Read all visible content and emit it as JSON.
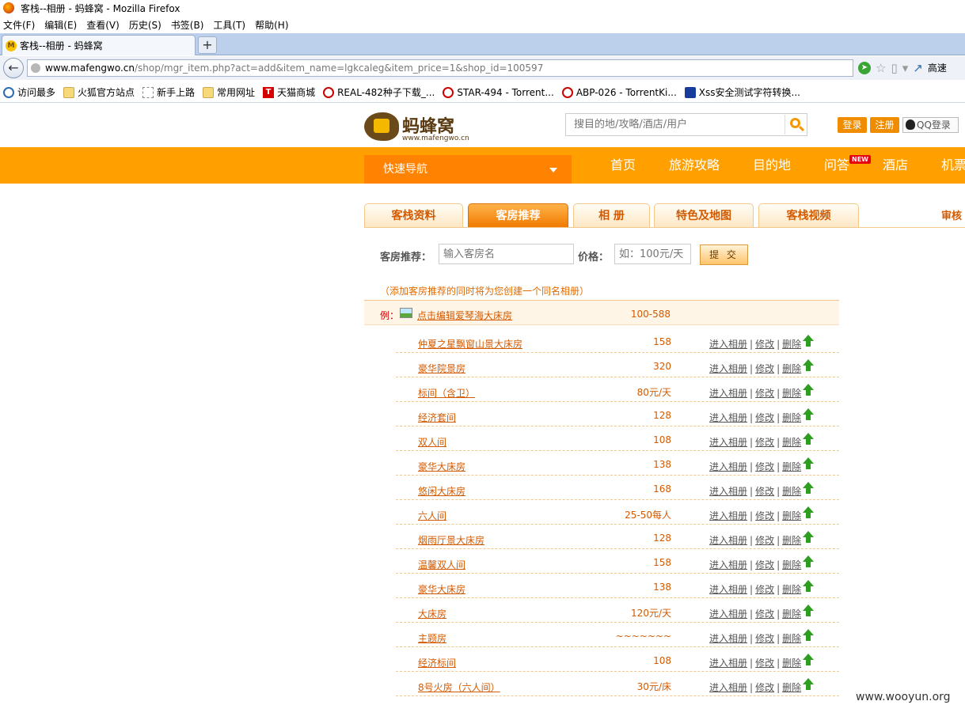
{
  "browser": {
    "window_title": "客栈--相册 - 蚂蜂窝 - Mozilla Firefox",
    "menu": [
      "文件(F)",
      "编辑(E)",
      "查看(V)",
      "历史(S)",
      "书签(B)",
      "工具(T)",
      "帮助(H)"
    ],
    "tab_title": "客栈--相册 - 蚂蜂窝",
    "url_host": "www.mafengwo.cn",
    "url_path": "/shop/mgr_item.php?act=add&item_name=lgkcaleg&item_price=1&shop_id=100597",
    "speed_label": "高速",
    "bookmarks": [
      "访问最多",
      "火狐官方站点",
      "新手上路",
      "常用网址",
      "天猫商城",
      "REAL-482种子下载_...",
      "STAR-494 - Torrent...",
      "ABP-026 - TorrentKi...",
      "Xss安全测试字符转换..."
    ]
  },
  "site": {
    "logo_text": "蚂蜂窝",
    "logo_sub": "www.mafengwo.cn",
    "search_placeholder": "搜目的地/攻略/酒店/用户",
    "login": "登录",
    "register": "注册",
    "qq_login": "QQ登录",
    "quick_nav": "快速导航",
    "nav": [
      "首页",
      "旅游攻略",
      "目的地",
      "问答",
      "酒店",
      "机票"
    ],
    "new_badge": "NEW"
  },
  "tabs": [
    "客栈资料",
    "客房推荐",
    "相 册",
    "特色及地图",
    "客栈视频"
  ],
  "tab_right": "审核",
  "form": {
    "room_label": "客房推荐：",
    "room_placeholder": "输入客房名",
    "price_label": "价格：",
    "price_placeholder": "如：100元/天",
    "submit": "提 交",
    "hint": "（添加客房推荐的同时将为您创建一个同名相册）"
  },
  "example": {
    "label": "例：",
    "name": "点击编辑爱琴海大床房",
    "price": "100-588"
  },
  "actions": {
    "enter_album": "进入相册",
    "edit": "修改",
    "delete": "删除",
    "sep": "|"
  },
  "rooms": [
    {
      "name": "仲夏之星飘窗山景大床房",
      "price": "158"
    },
    {
      "name": "豪华院景房",
      "price": "320"
    },
    {
      "name": "标间（含卫）",
      "price": "80元/天"
    },
    {
      "name": "经济套间",
      "price": "128"
    },
    {
      "name": "双人间",
      "price": "108"
    },
    {
      "name": "豪华大床房",
      "price": "138"
    },
    {
      "name": "悠闲大床房",
      "price": "168"
    },
    {
      "name": "六人间",
      "price": "25-50每人"
    },
    {
      "name": "烟雨厅景大床房",
      "price": "128"
    },
    {
      "name": "温馨双人间",
      "price": "158"
    },
    {
      "name": "豪华大床房",
      "price": "138"
    },
    {
      "name": "大床房",
      "price": "120元/天"
    },
    {
      "name": "主题房",
      "price": "~~~~~~~"
    },
    {
      "name": "经济标间",
      "price": "108"
    },
    {
      "name": "8号火房（六人间）",
      "price": "30元/床"
    }
  ],
  "watermark": "www.wooyun.org"
}
